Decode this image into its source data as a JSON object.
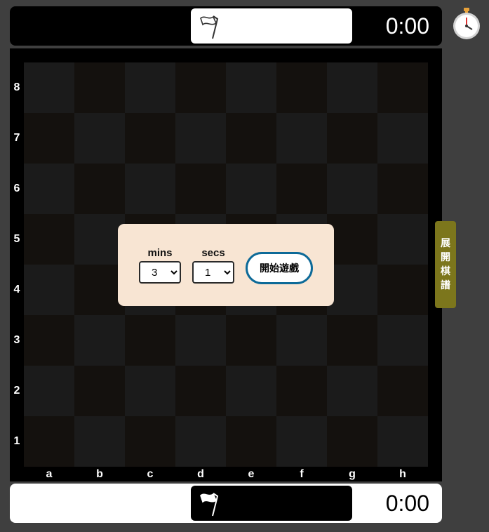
{
  "top_player": {
    "time": "0:00",
    "flag_icon": "white-flag-outline-icon"
  },
  "bottom_player": {
    "time": "0:00",
    "flag_icon": "white-flag-icon"
  },
  "board": {
    "ranks": [
      "8",
      "7",
      "6",
      "5",
      "4",
      "3",
      "2",
      "1"
    ],
    "files": [
      "a",
      "b",
      "c",
      "d",
      "e",
      "f",
      "g",
      "h"
    ]
  },
  "dialog": {
    "mins_label": "mins",
    "mins_value": "3",
    "secs_label": "secs",
    "secs_value": "1",
    "start_label": "開始遊戲"
  },
  "side_tab": {
    "chars": [
      "展",
      "開",
      "棋",
      "譜"
    ]
  },
  "colors": {
    "tab": "#7c761c",
    "button_border": "#0d6a98",
    "dialog_bg": "#f8e5d3"
  }
}
